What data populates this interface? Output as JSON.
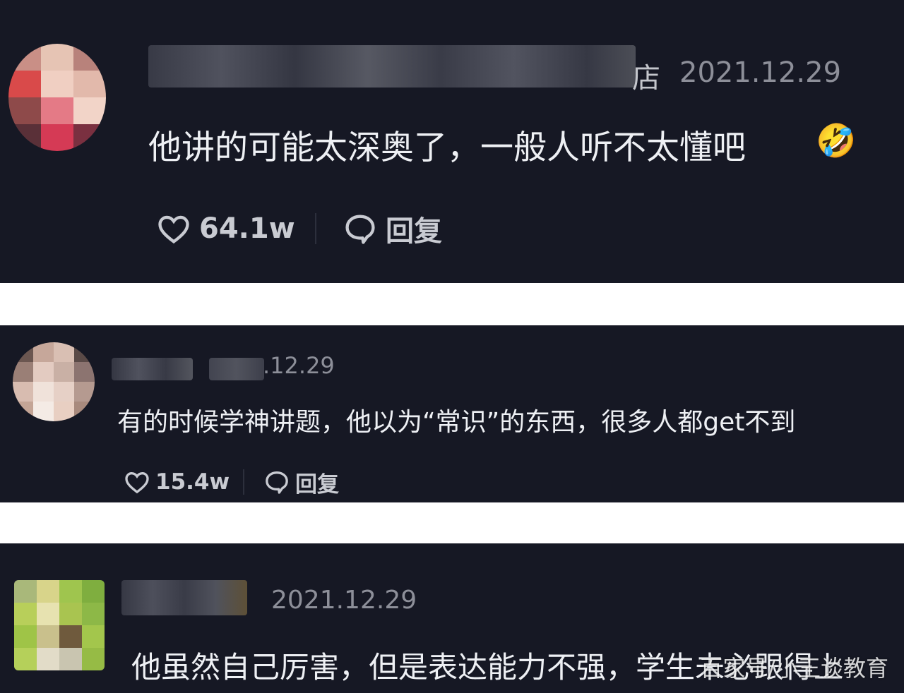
{
  "comments": [
    {
      "username_suffix": "店",
      "date": "2021.12.29",
      "text": "他讲的可能太深奥了，一般人听不太懂吧",
      "emoji": "🤣",
      "likes": "64.1w",
      "reply_label": "回复"
    },
    {
      "date": ".12.29",
      "text": "有的时候学神讲题，他以为“常识”的东西，很多人都get不到",
      "likes": "15.4w",
      "reply_label": "回复"
    },
    {
      "date": "2021.12.29",
      "text": "他虽然自己厉害，但是表达能力不强，学生未必跟得上"
    }
  ],
  "watermark": "百家号/小王谈教育",
  "colors": {
    "card_bg": "#161824",
    "page_bg": "#ffffff",
    "text": "#eef0f4",
    "muted": "#8d8f99"
  }
}
